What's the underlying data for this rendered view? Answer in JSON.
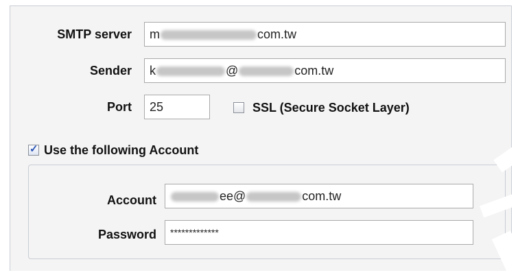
{
  "smtp": {
    "server_label": "SMTP server",
    "server_value_prefix": "m",
    "server_value_suffix": "com.tw",
    "sender_label": "Sender",
    "sender_value_prefix": "k",
    "sender_value_at": "@",
    "sender_value_suffix": "com.tw",
    "port_label": "Port",
    "port_value": "25",
    "ssl_label": "SSL (Secure Socket Layer)",
    "ssl_checked": false
  },
  "account_section": {
    "use_account_label": "Use the following Account",
    "use_account_checked": true,
    "account_label": "Account",
    "account_value_mid": "ee@",
    "account_value_suffix": "com.tw",
    "password_label": "Password",
    "password_value": "*************"
  },
  "colors": {
    "panel_bg": "#f4f4f4",
    "field_border": "#a9a9a9",
    "check_color": "#2b55b5"
  }
}
